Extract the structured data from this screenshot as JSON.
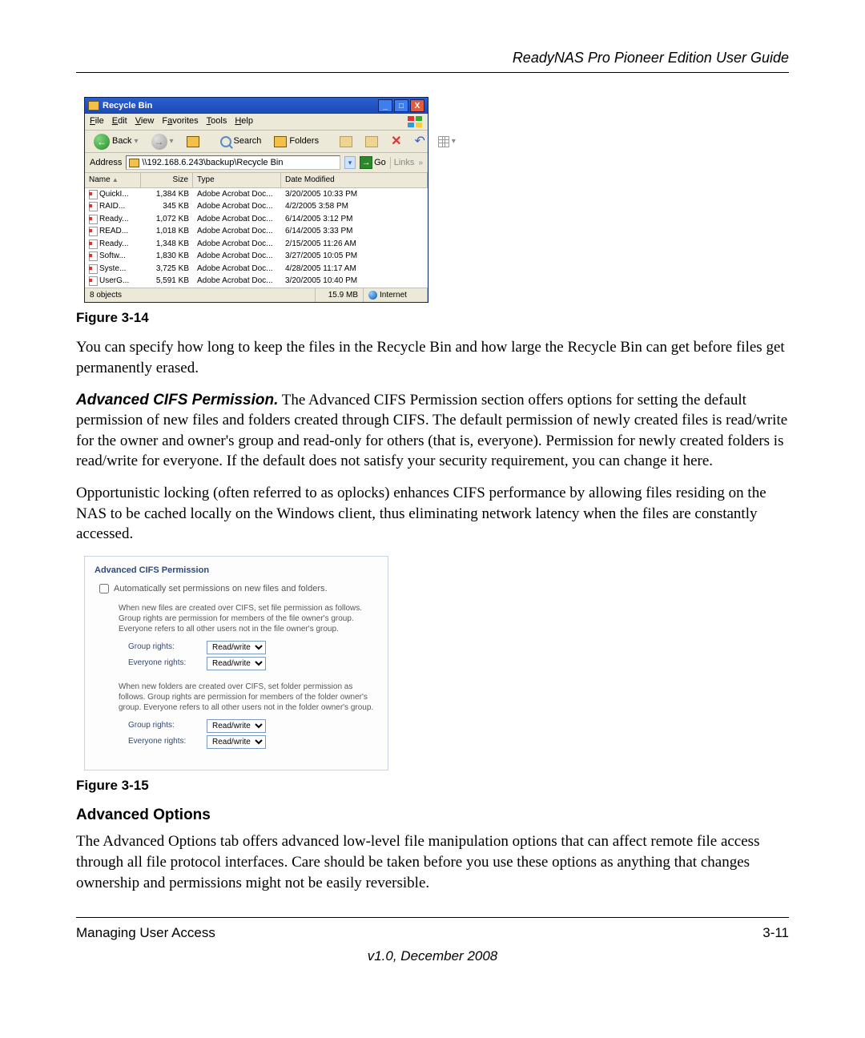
{
  "header": {
    "title": "ReadyNAS Pro Pioneer Edition User Guide"
  },
  "recycle_window": {
    "title": "Recycle Bin",
    "menu": {
      "file": "File",
      "edit": "Edit",
      "view": "View",
      "favorites": "Favorites",
      "tools": "Tools",
      "help": "Help"
    },
    "toolbar": {
      "back": "Back",
      "search": "Search",
      "folders": "Folders"
    },
    "address_label": "Address",
    "address_value": "\\\\192.168.6.243\\backup\\Recycle Bin",
    "go_label": "Go",
    "links_label": "Links",
    "columns": {
      "name": "Name",
      "size": "Size",
      "type": "Type",
      "date": "Date Modified"
    },
    "rows": [
      {
        "name": "QuickI...",
        "size": "1,384 KB",
        "type": "Adobe Acrobat Doc...",
        "date": "3/20/2005 10:33 PM"
      },
      {
        "name": "RAID...",
        "size": "345 KB",
        "type": "Adobe Acrobat Doc...",
        "date": "4/2/2005 3:58 PM"
      },
      {
        "name": "Ready...",
        "size": "1,072 KB",
        "type": "Adobe Acrobat Doc...",
        "date": "6/14/2005 3:12 PM"
      },
      {
        "name": "READ...",
        "size": "1,018 KB",
        "type": "Adobe Acrobat Doc...",
        "date": "6/14/2005 3:33 PM"
      },
      {
        "name": "Ready...",
        "size": "1,348 KB",
        "type": "Adobe Acrobat Doc...",
        "date": "2/15/2005 11:26 AM"
      },
      {
        "name": "Softw...",
        "size": "1,830 KB",
        "type": "Adobe Acrobat Doc...",
        "date": "3/27/2005 10:05 PM"
      },
      {
        "name": "Syste...",
        "size": "3,725 KB",
        "type": "Adobe Acrobat Doc...",
        "date": "4/28/2005 11:17 AM"
      },
      {
        "name": "UserG...",
        "size": "5,591 KB",
        "type": "Adobe Acrobat Doc...",
        "date": "3/20/2005 10:40 PM"
      }
    ],
    "status": {
      "objects": "8 objects",
      "size": "15.9 MB",
      "zone": "Internet"
    }
  },
  "fig14_caption": "Figure 3-14",
  "para1": "You can specify how long to keep the files in the Recycle Bin and how large the Recycle Bin can get before files get permanently erased.",
  "cifs_inline_head": "Advanced CIFS Permission.",
  "cifs_inline_body": " The Advanced CIFS Permission section offers options for setting the default permission of new files and folders created through CIFS. The default permission of newly created files is read/write for the owner and owner's group and read-only for others (that is, everyone). Permission for newly created folders is read/write for everyone. If the default does not satisfy your security requirement, you can change it here.",
  "para3": "Opportunistic locking (often referred to as oplocks) enhances CIFS performance by allowing files residing on the NAS to be cached locally on the Windows client, thus eliminating network latency when the files are constantly accessed.",
  "cifs_panel": {
    "title": "Advanced CIFS Permission",
    "checkbox_label": "Automatically set permissions on new files and folders.",
    "file_text": "When new files are created over CIFS, set file permission as follows. Group rights are permission for members of the file owner's group. Everyone refers to all other users not in the file owner's group.",
    "folder_text": "When new folders are created over CIFS, set folder permission as follows. Group rights are permission for members of the folder owner's group. Everyone refers to all other users not in the folder owner's group.",
    "group_label": "Group rights:",
    "everyone_label": "Everyone rights:",
    "option": "Read/write"
  },
  "fig15_caption": "Figure 3-15",
  "adv_options_heading": "Advanced Options",
  "para4": "The Advanced Options tab offers advanced low-level file manipulation options that can affect remote file access through all file protocol interfaces. Care should be taken before you use these options as anything that changes ownership and permissions might not be easily reversible.",
  "footer": {
    "left": "Managing User Access",
    "right": "3-11",
    "version": "v1.0, December 2008"
  }
}
